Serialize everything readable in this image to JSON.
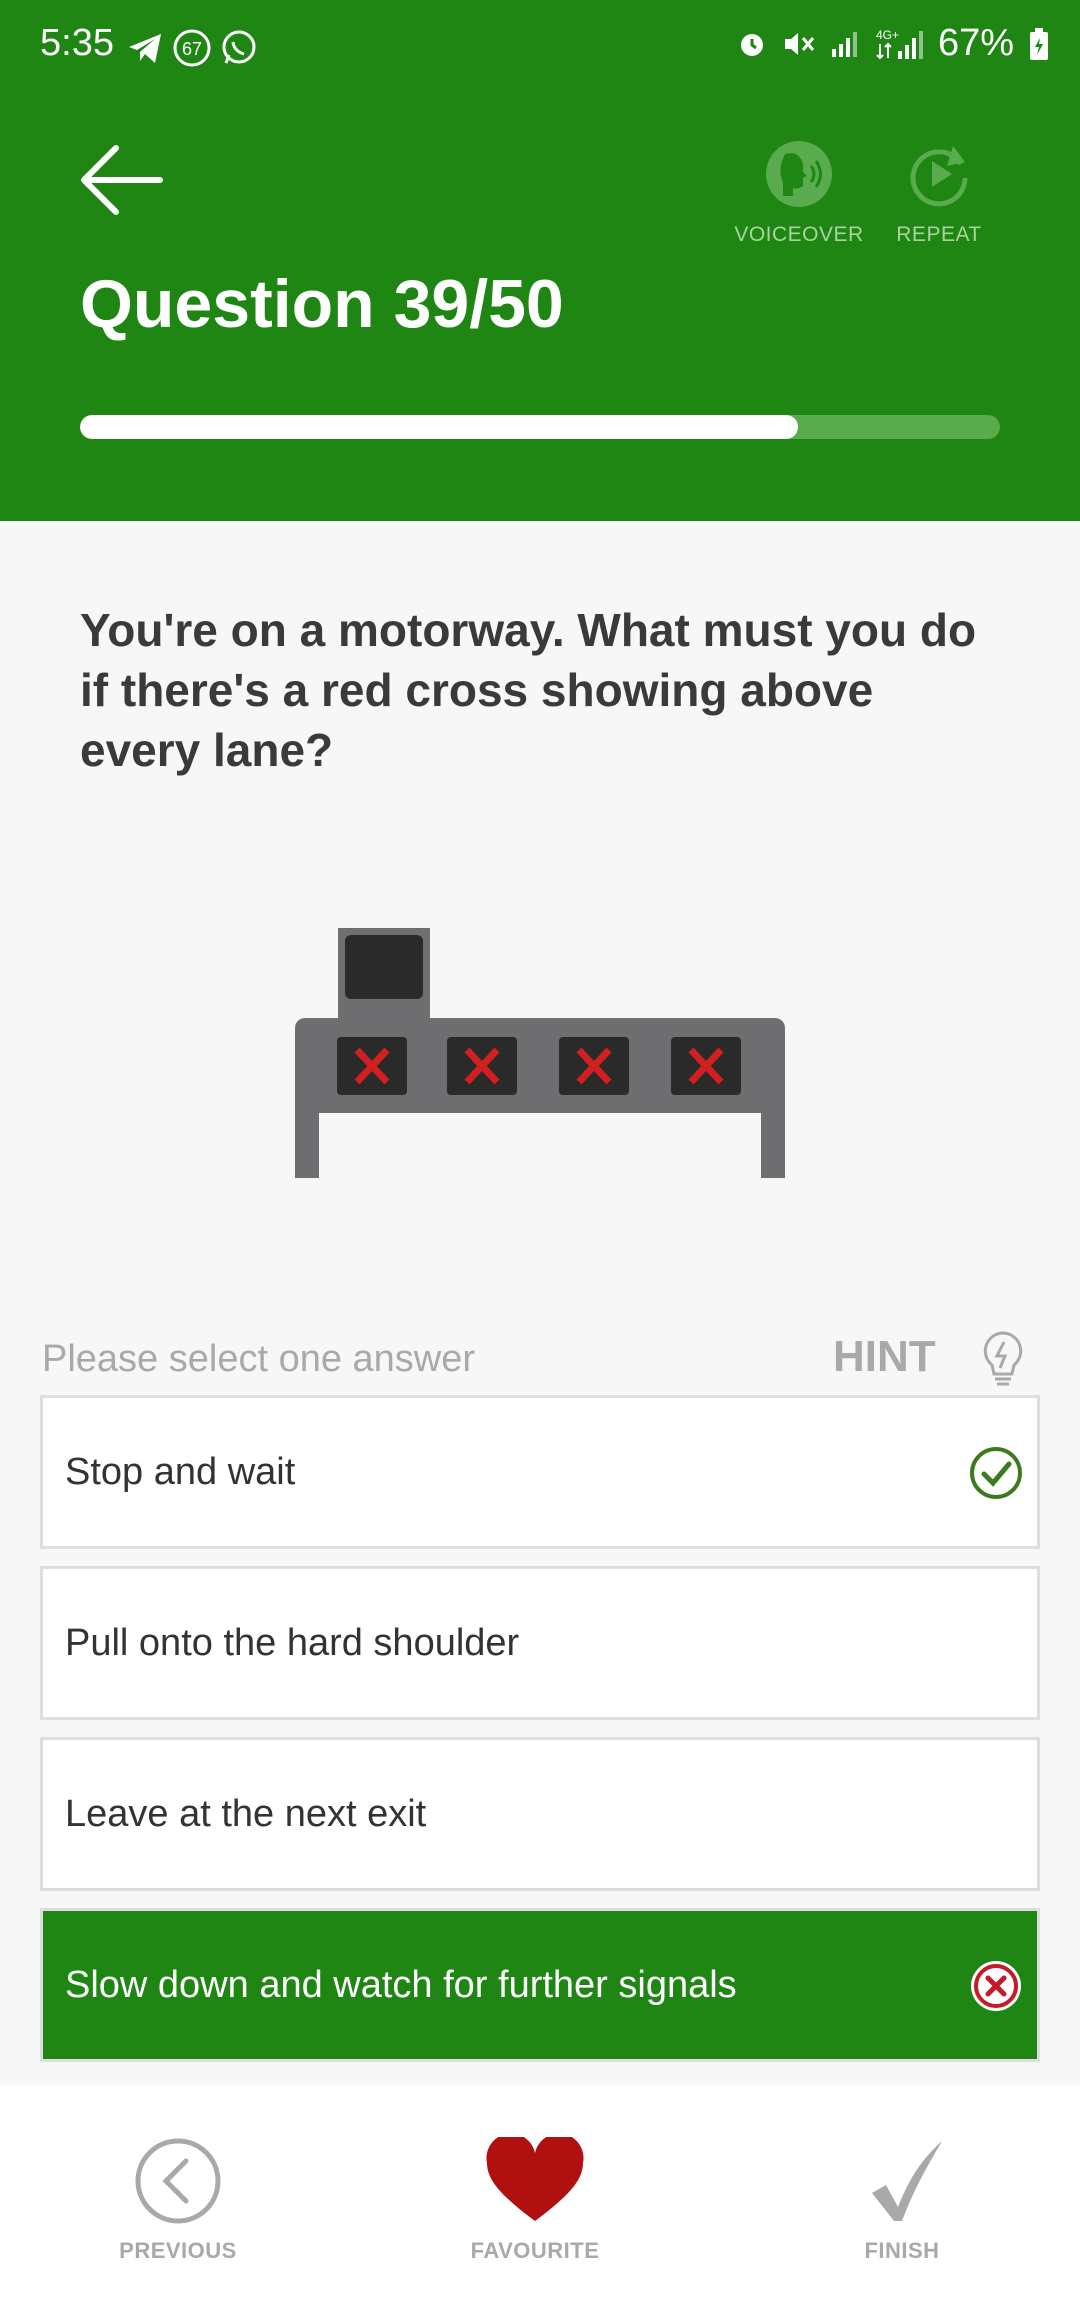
{
  "status_bar": {
    "time": "5:35",
    "badge_number": "67",
    "battery": "67%"
  },
  "header": {
    "title": "Question 39/50",
    "voiceover_label": "VOICEOVER",
    "repeat_label": "REPEAT",
    "progress_fraction": 0.78,
    "background_color": "#1f8614"
  },
  "question": {
    "text": "You're on a motorway. What must you do if there's a red cross showing above every lane?",
    "image": "motorway-gantry-red-crosses"
  },
  "answers_section": {
    "instruction": "Please select one answer",
    "hint_label": "HINT",
    "answers": [
      {
        "label": "Stop and wait",
        "status": "correct"
      },
      {
        "label": "Pull onto the hard shoulder",
        "status": "none"
      },
      {
        "label": "Leave at the next exit",
        "status": "none"
      },
      {
        "label": "Slow down and watch for further signals",
        "status": "selected-wrong"
      }
    ]
  },
  "footer": {
    "previous_label": "PREVIOUS",
    "favourite_label": "FAVOURITE",
    "finish_label": "FINISH",
    "favourite_color": "#b01010"
  }
}
